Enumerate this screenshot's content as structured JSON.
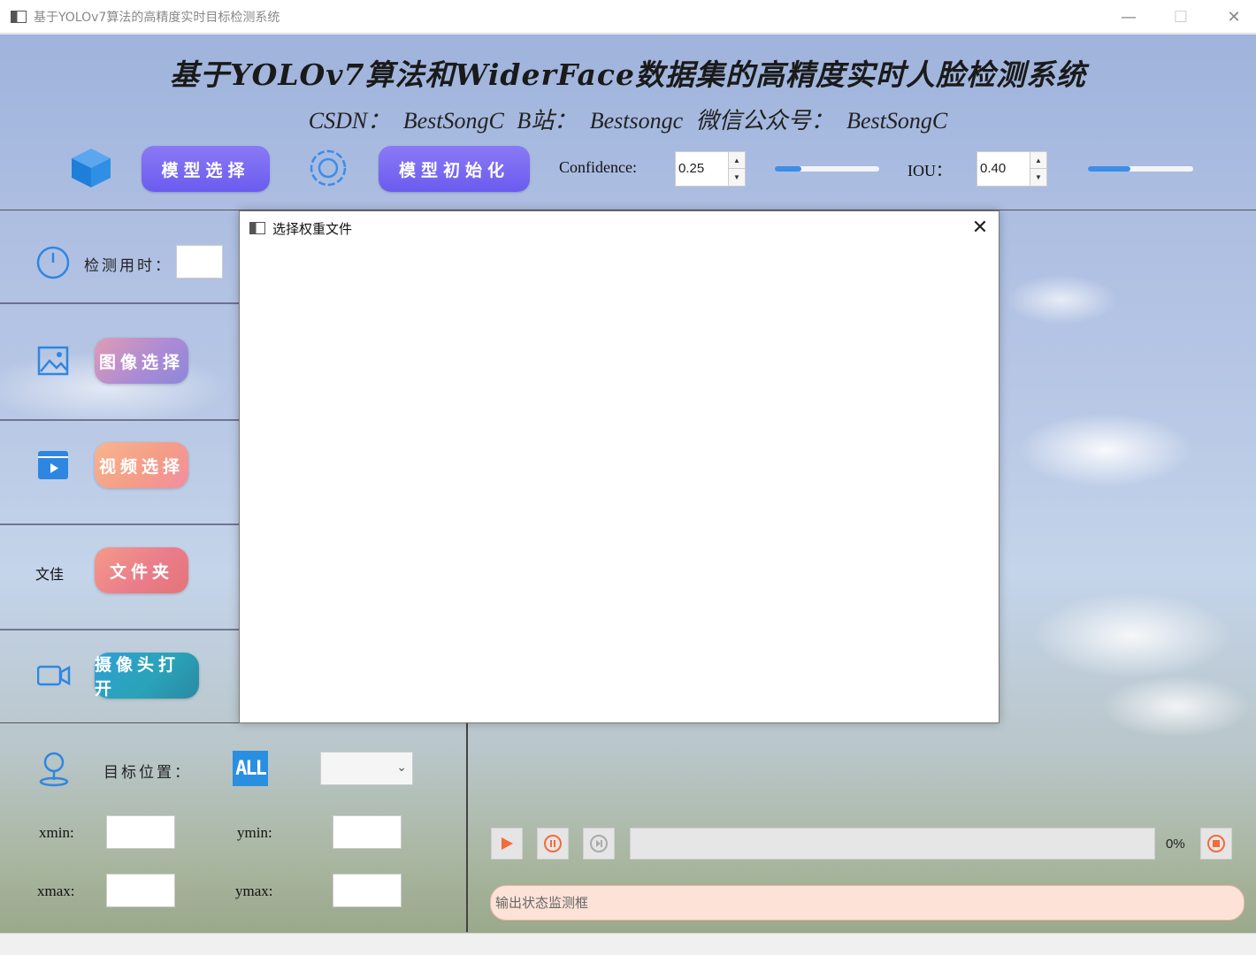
{
  "window": {
    "title": "基于YOLOv7算法的高精度实时目标检测系统",
    "min_glyph": "—",
    "max_glyph": "☐",
    "close_glyph": "✕"
  },
  "header": {
    "title": "基于YOLOv7算法和WiderFace数据集的高精度实时人脸检测系统",
    "subtitle": "CSDN： BestSongC B站： Bestsongc 微信公众号： BestSongC"
  },
  "toolbar": {
    "model_select_label": "模型选择",
    "model_init_label": "模型初始化",
    "confidence_label": "Confidence:",
    "confidence_value": "0.25",
    "confidence_fraction": 0.25,
    "iou_label": "IOU：",
    "iou_value": "0.40",
    "iou_fraction": 0.4,
    "spin_up": "▲",
    "spin_down": "▼"
  },
  "left_panel": {
    "detect_time_label": "检测用时：",
    "detect_time_value": "",
    "image_select_label": "图像选择",
    "video_select_label": "视频选择",
    "folder_text_label": "文佳",
    "folder_label": "文件夹",
    "camera_open_label": "摄像头打开"
  },
  "target": {
    "label": "目标位置：",
    "all_badge": "ALL",
    "combo_value": "",
    "combo_chevron": "⌄",
    "xmin_label": "xmin:",
    "ymin_label": "ymin:",
    "xmax_label": "xmax:",
    "ymax_label": "ymax:",
    "xmin": "",
    "ymin": "",
    "xmax": "",
    "ymax": ""
  },
  "media": {
    "progress_percent": "0%",
    "progress_fraction": 0
  },
  "status": {
    "placeholder": "输出状态监测框"
  },
  "dialog": {
    "title": "选择权重文件",
    "close_glyph": "✕"
  },
  "colors": {
    "accent_purple": "#6b5bef",
    "slider_blue": "#3c8ee6",
    "all_badge_blue": "#2a8fe0",
    "play_orange": "#f26b3a",
    "status_bg": "#fde3d7"
  },
  "icons": {
    "cube": "cube-icon",
    "gear": "gear-icon",
    "clock": "clock-icon",
    "image": "image-icon",
    "video": "video-icon",
    "camera": "camera-icon",
    "pin": "map-pin-icon",
    "play": "play-icon",
    "pause": "pause-icon",
    "next": "skip-icon",
    "record": "record-icon"
  }
}
